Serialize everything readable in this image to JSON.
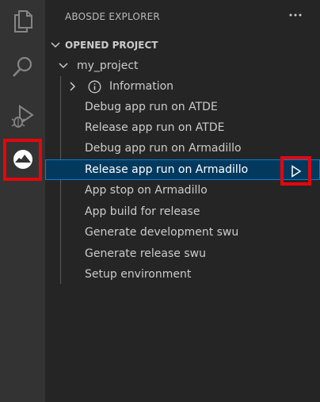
{
  "activity_bar": {
    "icons": [
      "explorer-files-icon",
      "search-icon",
      "run-and-debug-icon",
      "abosde-extension-icon"
    ],
    "highlight_color": "#e5060d"
  },
  "sidebar": {
    "title": "ABOSDE EXPLORER",
    "more_actions": "···",
    "section": "OPENED PROJECT",
    "project": "my_project",
    "info_label": "Information",
    "commands": [
      "Debug app run on ATDE",
      "Release app run on ATDE",
      "Debug app run on Armadillo",
      "Release app run on Armadillo",
      "App stop on Armadillo",
      "App build for release",
      "Generate development swu",
      "Generate release swu",
      "Setup environment"
    ],
    "selected_command": "Release app run on Armadillo",
    "selected_bg": "#04395e"
  }
}
